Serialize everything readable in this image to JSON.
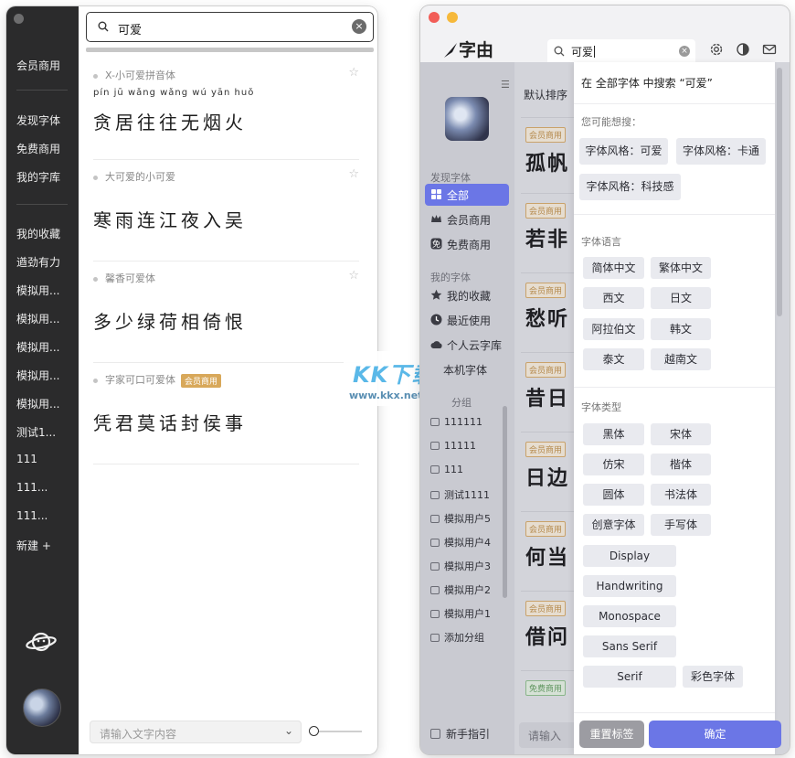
{
  "left_window": {
    "sidebar": {
      "top_items": [
        {
          "label": "会员商用"
        }
      ],
      "nav_items": [
        {
          "label": "发现字体"
        },
        {
          "label": "免费商用"
        },
        {
          "label": "我的字库"
        }
      ],
      "collection_items": [
        {
          "label": "我的收藏"
        },
        {
          "label": "遒劲有力"
        },
        {
          "label": "模拟用..."
        },
        {
          "label": "模拟用..."
        },
        {
          "label": "模拟用..."
        },
        {
          "label": "模拟用..."
        },
        {
          "label": "模拟用..."
        },
        {
          "label": "测试1..."
        },
        {
          "label": "111"
        },
        {
          "label": "111..."
        },
        {
          "label": "111..."
        },
        {
          "label": "新建 +"
        }
      ]
    },
    "search": {
      "value": "可爱",
      "clear_label": "×"
    },
    "fonts": [
      {
        "name": "X-小可爱拼音体",
        "sample": "贪居往往无烟火",
        "pinyin": "pín  jū  wǎng wǎng  wú   yān  huǒ",
        "badge": ""
      },
      {
        "name": "大可爱的小可爱",
        "sample": "寒雨连江夜入吴",
        "pinyin": "",
        "badge": ""
      },
      {
        "name": "馨香可爱体",
        "sample": "多少绿荷相倚恨",
        "pinyin": "",
        "badge": ""
      },
      {
        "name": "字家可口可爱体",
        "sample": "凭君莫话封侯事",
        "pinyin": "",
        "badge": "会员商用"
      }
    ],
    "star": "☆",
    "bottom_input": {
      "placeholder": "请输入文字内容",
      "chevron": "⌄"
    }
  },
  "watermark": {
    "title": "KK下载",
    "sub": "www.kkx.net"
  },
  "right_window": {
    "app_name": "字由",
    "search": {
      "value": "可爱",
      "clear_label": "×"
    },
    "sidebar": {
      "section_discover": "发现字体",
      "discover_items": [
        {
          "label": "全部",
          "active": true
        },
        {
          "label": "会员商用"
        },
        {
          "label": "免费商用"
        }
      ],
      "section_mine": "我的字体",
      "mine_items": [
        {
          "label": "我的收藏"
        },
        {
          "label": "最近使用"
        },
        {
          "label": "个人云字库"
        },
        {
          "label": "本机字体"
        }
      ],
      "section_groups": "分组",
      "groups": [
        {
          "label": "111111"
        },
        {
          "label": "11111"
        },
        {
          "label": "111"
        },
        {
          "label": "测试1111"
        },
        {
          "label": "模拟用户5"
        },
        {
          "label": "模拟用户4"
        },
        {
          "label": "模拟用户3"
        },
        {
          "label": "模拟用户2"
        },
        {
          "label": "模拟用户1"
        },
        {
          "label": "添加分组"
        }
      ],
      "guide": "新手指引"
    },
    "list": {
      "sort_label": "默认排序",
      "rows": [
        {
          "tag": "会员商用",
          "sample": "孤帆",
          "free": false
        },
        {
          "tag": "会员商用",
          "sample": "若非",
          "free": false
        },
        {
          "tag": "会员商用",
          "sample": "愁听",
          "free": false
        },
        {
          "tag": "会员商用",
          "sample": "昔日",
          "free": false
        },
        {
          "tag": "会员商用",
          "sample": "日边",
          "free": false
        },
        {
          "tag": "会员商用",
          "sample": "何当",
          "free": false
        },
        {
          "tag": "会员商用",
          "sample": "借问",
          "free": false
        },
        {
          "tag": "免费商用",
          "sample": "",
          "free": true
        }
      ],
      "input_placeholder": "请输入"
    },
    "panel": {
      "search_in_all": "在 全部字体 中搜索 “可爱”",
      "suggest_label": "您可能想搜：",
      "suggestions": [
        "字体风格：可爱",
        "字体风格：卡通",
        "字体风格：科技感"
      ],
      "language_label": "字体语言",
      "languages": [
        "简体中文",
        "繁体中文",
        "西文",
        "日文",
        "阿拉伯文",
        "韩文",
        "泰文",
        "越南文"
      ],
      "type_label": "字体类型",
      "types": [
        "黑体",
        "宋体",
        "仿宋",
        "楷体",
        "圆体",
        "书法体",
        "创意字体",
        "手写体",
        "Display",
        "Handwriting",
        "Monospace",
        "Sans Serif",
        "Serif",
        "彩色字体"
      ],
      "reset_label": "重置标签",
      "ok_label": "确定"
    }
  },
  "colors": {
    "accent": "#6b76e6",
    "vip_badge": "#d8a85a",
    "dark_sidebar": "#2b2b2c",
    "traffic_red": "#f25d57",
    "traffic_yellow": "#f6b93b"
  }
}
